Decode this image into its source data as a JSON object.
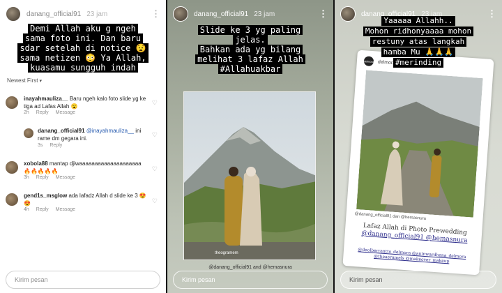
{
  "panels": [
    {
      "username": "danang_official91",
      "time": "23 jam",
      "text_lines": [
        "Demi Allah aku g ngeh",
        "sama foto ini. Dan baru",
        "sdar setelah di notice 😧",
        "sama netizen 😳 Ya Allah,",
        "kuasamu sungguh indah"
      ],
      "sort_label": "Newest First",
      "comments": [
        {
          "user": "inayahmauliza__",
          "text": "Baru ngeh kalo foto slide yg ke tiga ad Lafas Allah 😮",
          "age": "2h",
          "reply": "Reply",
          "message": "Message"
        },
        {
          "user": "danang_official91",
          "mention": "@inayahmauliza__",
          "text": "ini rame dm gegara ini.",
          "age": "3s",
          "reply": "Reply"
        },
        {
          "user": "xobola88",
          "text": "mantap djiwaaaaaaaaaaaaaaaaaaaa 🔥🔥🔥🔥🔥",
          "age": "3h",
          "reply": "Reply",
          "message": "Message"
        },
        {
          "user": "gend1s_msglow",
          "text": "ada lafadz Allah d slide ke 3 😍😍",
          "age": "4h",
          "reply": "Reply",
          "message": "Message"
        }
      ],
      "input_placeholder": "Kirim pesan"
    },
    {
      "username": "danang_official91",
      "time": "23 jam",
      "text_lines": [
        "Slide ke 3 yg paling",
        "jelas.",
        "Bahkan ada yg bilang",
        "melihat 3 lafaz Allah",
        "#Allahuakbar"
      ],
      "photo_watermark": "theogramem",
      "tag_line": "@danang_official91 and @hemasnura",
      "input_placeholder": "Kirim pesan"
    },
    {
      "username": "danang_official91",
      "time": "23 jam",
      "text_lines": [
        "Yaaaaa Allahh..",
        "Mohon ridhonyaaaa mohon",
        "restuny atas langkah",
        "hamba Mu 🙏🙏🙏",
        "#merinding"
      ],
      "card_account": "delmorattire",
      "card_logo": "delmora",
      "card_tags": "@danang_official91 dan @hemasnura",
      "card_caption_1": "Lafaz Allah di Photo Prewedding",
      "card_caption_2": "@danang_official91 @hemasnura",
      "card_credits": "@deolberrantto_delmora @aninwardhana_delmora @theaeramels @makeover_makeup",
      "input_placeholder": "Kirim pesan"
    }
  ]
}
